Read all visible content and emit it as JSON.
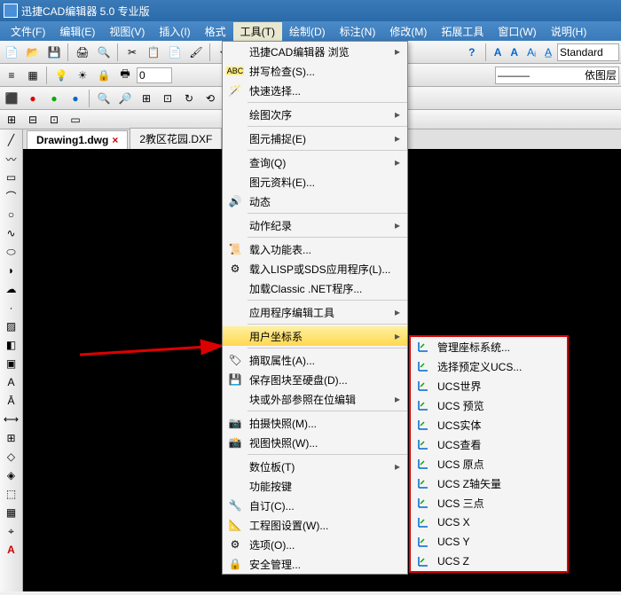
{
  "title": "迅捷CAD编辑器 5.0 专业版",
  "menu": {
    "file": "文件(F)",
    "edit": "编辑(E)",
    "view": "视图(V)",
    "insert": "插入(I)",
    "format": "格式",
    "tools": "工具(T)",
    "draw": "绘制(D)",
    "annotate": "标注(N)",
    "modify": "修改(M)",
    "expand": "拓展工具",
    "window": "窗口(W)",
    "help": "说明(H)"
  },
  "tb2": {
    "input": "0"
  },
  "tb_right": {
    "std": "Standard",
    "layer": "依图层"
  },
  "tabs": [
    {
      "label": "Drawing1.dwg",
      "active": true,
      "close": true
    },
    {
      "label": "2教区花园.DXF",
      "active": false,
      "close": false
    }
  ],
  "tools_menu": [
    {
      "label": "迅捷CAD编辑器 浏览",
      "arrow": true
    },
    {
      "icon": "abc",
      "label": "拼写检查(S)..."
    },
    {
      "icon": "wand",
      "label": "快速选择..."
    },
    {
      "sep": true
    },
    {
      "label": "绘图次序",
      "arrow": true
    },
    {
      "sep": true
    },
    {
      "label": "图元捕捉(E)",
      "arrow": true
    },
    {
      "sep": true
    },
    {
      "label": "查询(Q)",
      "arrow": true
    },
    {
      "label": "图元资料(E)..."
    },
    {
      "icon": "speaker",
      "label": "动态"
    },
    {
      "sep": true
    },
    {
      "label": "动作纪录",
      "arrow": true
    },
    {
      "sep": true
    },
    {
      "icon": "ribbon",
      "label": "载入功能表..."
    },
    {
      "icon": "gear",
      "label": "载入LISP或SDS应用程序(L)..."
    },
    {
      "label": "加载Classic .NET程序..."
    },
    {
      "sep": true
    },
    {
      "label": "应用程序编辑工具",
      "arrow": true
    },
    {
      "sep": true
    },
    {
      "label": "用户坐标系",
      "arrow": true,
      "hl": true
    },
    {
      "sep": true
    },
    {
      "icon": "tag",
      "label": "摘取属性(A)..."
    },
    {
      "icon": "disk",
      "label": "保存图块至硬盘(D)..."
    },
    {
      "label": "块或外部参照在位编辑",
      "arrow": true
    },
    {
      "sep": true
    },
    {
      "icon": "camera",
      "label": "拍摄快照(M)..."
    },
    {
      "icon": "camera2",
      "label": "视图快照(W)..."
    },
    {
      "sep": true
    },
    {
      "label": "数位板(T)",
      "arrow": true
    },
    {
      "label": "功能按键"
    },
    {
      "icon": "cust",
      "label": "自订(C)..."
    },
    {
      "icon": "pset",
      "label": "工程图设置(W)..."
    },
    {
      "icon": "opt",
      "label": "选项(O)..."
    },
    {
      "icon": "sec",
      "label": "安全管理..."
    }
  ],
  "ucs_menu": [
    {
      "label": "管理座标系统..."
    },
    {
      "label": "选择预定义UCS..."
    },
    {
      "label": "UCS世界"
    },
    {
      "label": "UCS 预览"
    },
    {
      "label": "UCS实体"
    },
    {
      "label": "UCS查看"
    },
    {
      "label": "UCS 原点"
    },
    {
      "label": "UCS Z轴矢量"
    },
    {
      "label": "UCS 三点"
    },
    {
      "label": "UCS X"
    },
    {
      "label": "UCS Y"
    },
    {
      "label": "UCS Z"
    }
  ]
}
